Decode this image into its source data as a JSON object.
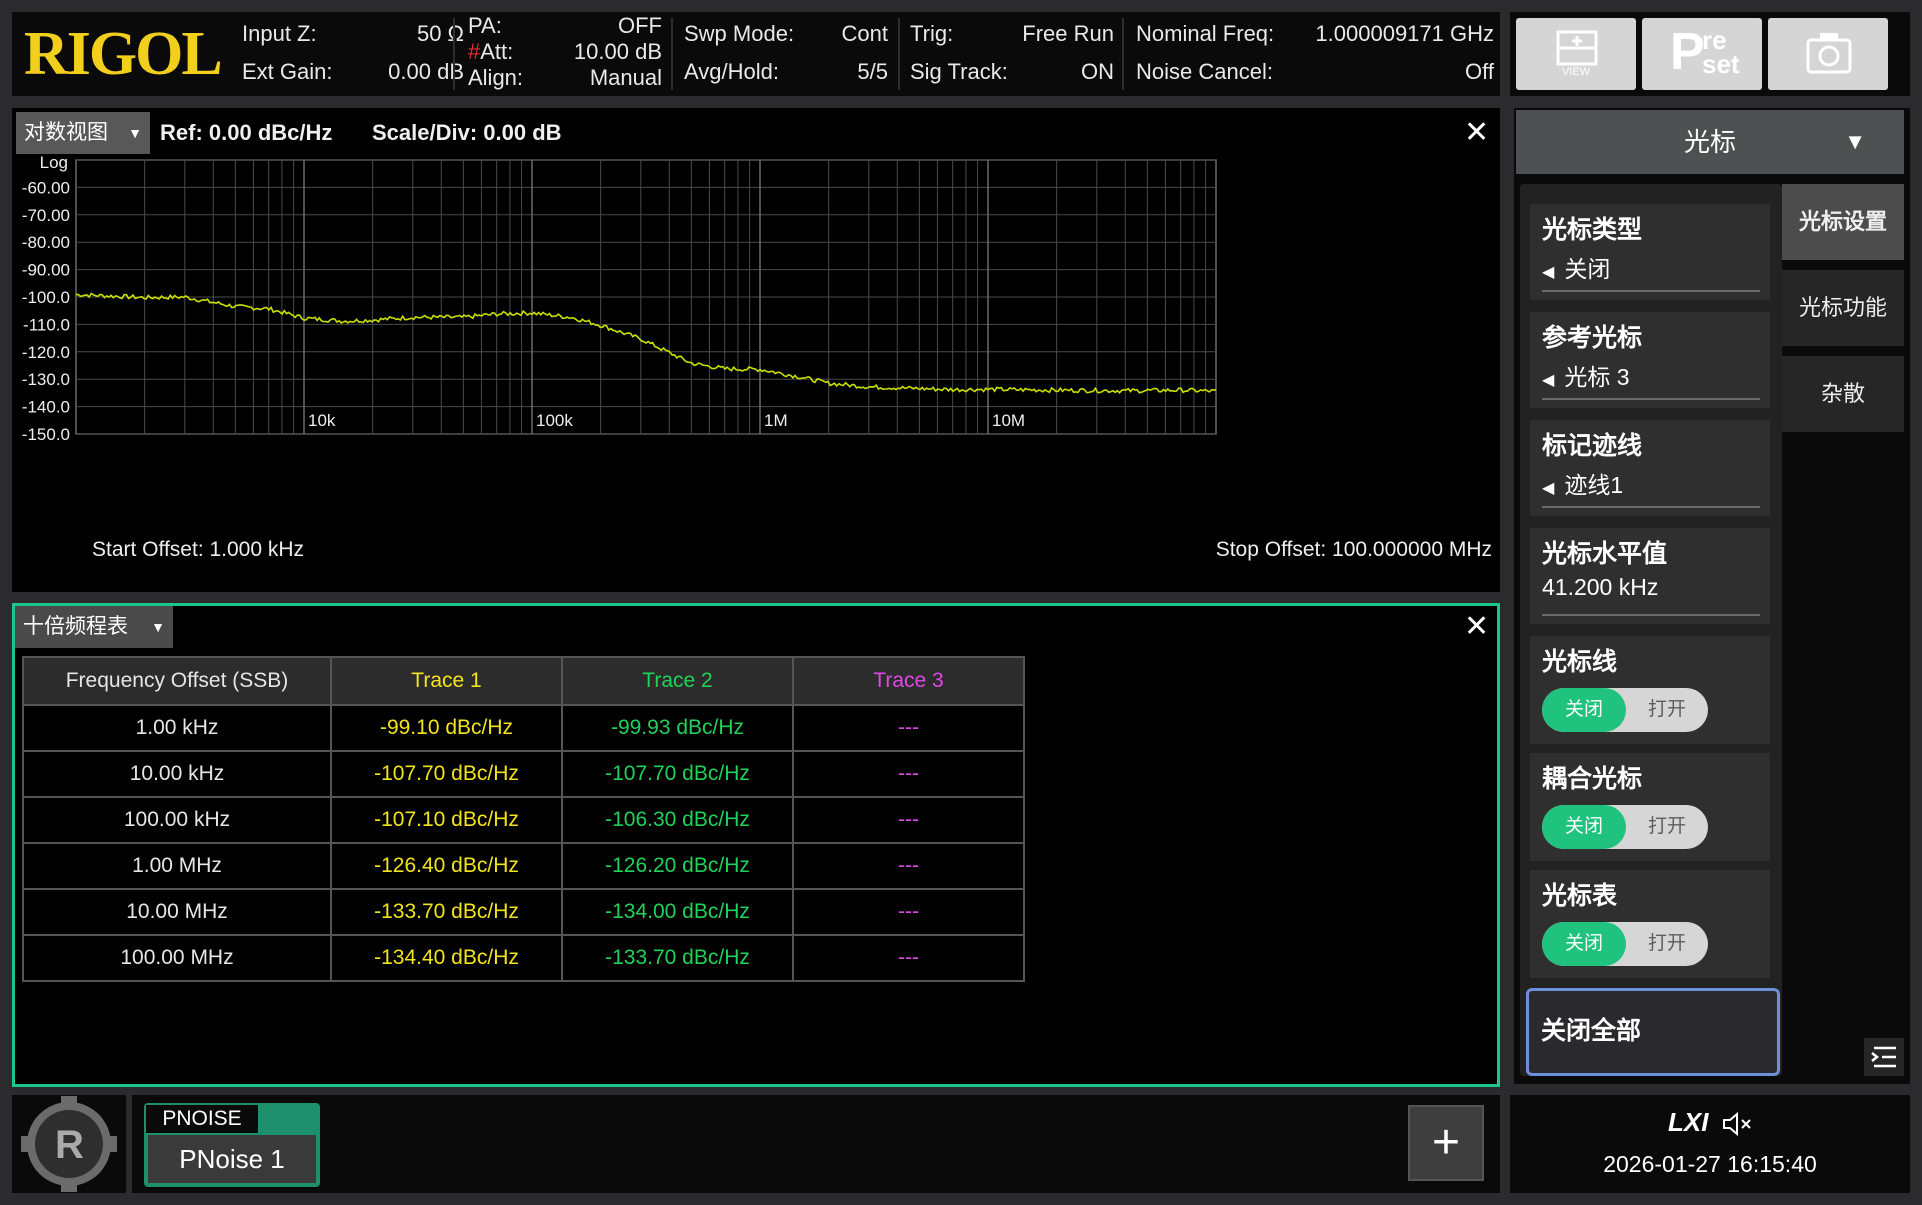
{
  "brand": {
    "logo_text": "RIGOL",
    "logo_color": "#f2cf1c"
  },
  "header": {
    "input_z_label": "Input Z:",
    "input_z_value": "50 Ω",
    "ext_gain_label": "Ext Gain:",
    "ext_gain_value": "0.00 dB",
    "pa_label": "PA:",
    "pa_value": "OFF",
    "att_mark": "#",
    "att_label": "Att:",
    "att_value": "10.00 dB",
    "align_label": "Align:",
    "align_value": "Manual",
    "swp_mode_label": "Swp Mode:",
    "swp_mode_value": "Cont",
    "avg_label": "Avg/Hold:",
    "avg_value": "5/5",
    "trig_label": "Trig:",
    "trig_value": "Free Run",
    "sig_track_label": "Sig Track:",
    "sig_track_value": "ON",
    "nominal_freq_label": "Nominal Freq:",
    "nominal_freq_value": "1.000009171 GHz",
    "noise_cancel_label": "Noise Cancel:",
    "noise_cancel_value": "Off",
    "buttons": [
      {
        "name": "view-button",
        "icon": "view-icon",
        "label": "VIEW"
      },
      {
        "name": "preset-button",
        "icon": "preset-icon",
        "label_big": "P",
        "label_top": "re",
        "label_bottom": "set"
      },
      {
        "name": "screenshot-button",
        "icon": "camera-icon"
      }
    ]
  },
  "plot": {
    "view_selector": "对数视图",
    "ref": "Ref: 0.00 dBc/Hz",
    "scale": "Scale/Div: 0.00 dB",
    "start_offset": "Start Offset: 1.000 kHz",
    "stop_offset": "Stop Offset: 100.000000 MHz"
  },
  "chart_data": {
    "type": "line",
    "x_scale": "log",
    "xlim": [
      1000,
      100000000
    ],
    "ylim": [
      -150,
      -50
    ],
    "x_tick_labels": [
      "10k",
      "100k",
      "1M",
      "10M"
    ],
    "x_ticks": [
      10000,
      100000,
      1000000,
      10000000
    ],
    "y_scale_label": "Log",
    "y_tick_labels": [
      "-60.00",
      "-70.00",
      "-80.00",
      "-90.00",
      "-100.0",
      "-110.0",
      "-120.0",
      "-130.0",
      "-140.0",
      "-150.0"
    ],
    "y_ticks": [
      -60,
      -70,
      -80,
      -90,
      -100,
      -110,
      -120,
      -130,
      -140,
      -150
    ],
    "grid": true,
    "series": [
      {
        "color": "#c8e000",
        "points": [
          [
            1000,
            -99.1
          ],
          [
            2000,
            -100.2
          ],
          [
            3000,
            -100.0
          ],
          [
            5000,
            -103.5
          ],
          [
            7000,
            -104.3
          ],
          [
            10000,
            -107.7
          ],
          [
            15000,
            -108.8
          ],
          [
            20000,
            -108.4
          ],
          [
            30000,
            -107.4
          ],
          [
            50000,
            -107.4
          ],
          [
            70000,
            -106.2
          ],
          [
            100000,
            -105.8
          ],
          [
            150000,
            -107.5
          ],
          [
            200000,
            -110.3
          ],
          [
            300000,
            -115.3
          ],
          [
            500000,
            -124.2
          ],
          [
            700000,
            -126.2
          ],
          [
            1000000,
            -126.4
          ],
          [
            1500000,
            -129.2
          ],
          [
            2000000,
            -131.5
          ],
          [
            3000000,
            -132.8
          ],
          [
            5000000,
            -133.4
          ],
          [
            7000000,
            -133.8
          ],
          [
            10000000,
            -133.7
          ],
          [
            20000000,
            -134.0
          ],
          [
            40000000,
            -134.2
          ],
          [
            70000000,
            -134.0
          ],
          [
            100000000,
            -134.4
          ]
        ]
      }
    ]
  },
  "table": {
    "selector": "十倍频程表",
    "headers": [
      "Frequency Offset (SSB)",
      "Trace 1",
      "Trace 2",
      "Trace 3"
    ],
    "header_colors": [
      "#e6e6e6",
      "#f2e41a",
      "#1fd25a",
      "#e046e8"
    ],
    "rows": [
      {
        "offset": "1.00 kHz",
        "t1": "-99.10 dBc/Hz",
        "t2": "-99.93 dBc/Hz",
        "t3": "---"
      },
      {
        "offset": "10.00 kHz",
        "t1": "-107.70 dBc/Hz",
        "t2": "-107.70 dBc/Hz",
        "t3": "---"
      },
      {
        "offset": "100.00 kHz",
        "t1": "-107.10 dBc/Hz",
        "t2": "-106.30 dBc/Hz",
        "t3": "---"
      },
      {
        "offset": "1.00 MHz",
        "t1": "-126.40 dBc/Hz",
        "t2": "-126.20 dBc/Hz",
        "t3": "---"
      },
      {
        "offset": "10.00 MHz",
        "t1": "-133.70 dBc/Hz",
        "t2": "-134.00 dBc/Hz",
        "t3": "---"
      },
      {
        "offset": "100.00 MHz",
        "t1": "-134.40 dBc/Hz",
        "t2": "-133.70 dBc/Hz",
        "t3": "---"
      }
    ]
  },
  "sidebar": {
    "menu_title": "光标",
    "tabs": [
      "光标设置",
      "光标功能",
      "杂散"
    ],
    "marker_type": {
      "title": "光标类型",
      "value": "关闭"
    },
    "ref_marker": {
      "title": "参考光标",
      "value": "光标 3"
    },
    "marker_trace": {
      "title": "标记迹线",
      "value": "迹线1"
    },
    "marker_x": {
      "title": "光标水平值",
      "value": "41.200 kHz"
    },
    "marker_line": {
      "title": "光标线",
      "off": "关闭",
      "on": "打开"
    },
    "couple_marker": {
      "title": "耦合光标",
      "off": "关闭",
      "on": "打开"
    },
    "marker_table": {
      "title": "光标表",
      "off": "关闭",
      "on": "打开"
    },
    "all_off": "关闭全部"
  },
  "bottom": {
    "mode_tag": "PNOISE",
    "mode_name": "PNoise 1",
    "lxi": "LXI",
    "datetime": "2026-01-27 16:15:40"
  }
}
